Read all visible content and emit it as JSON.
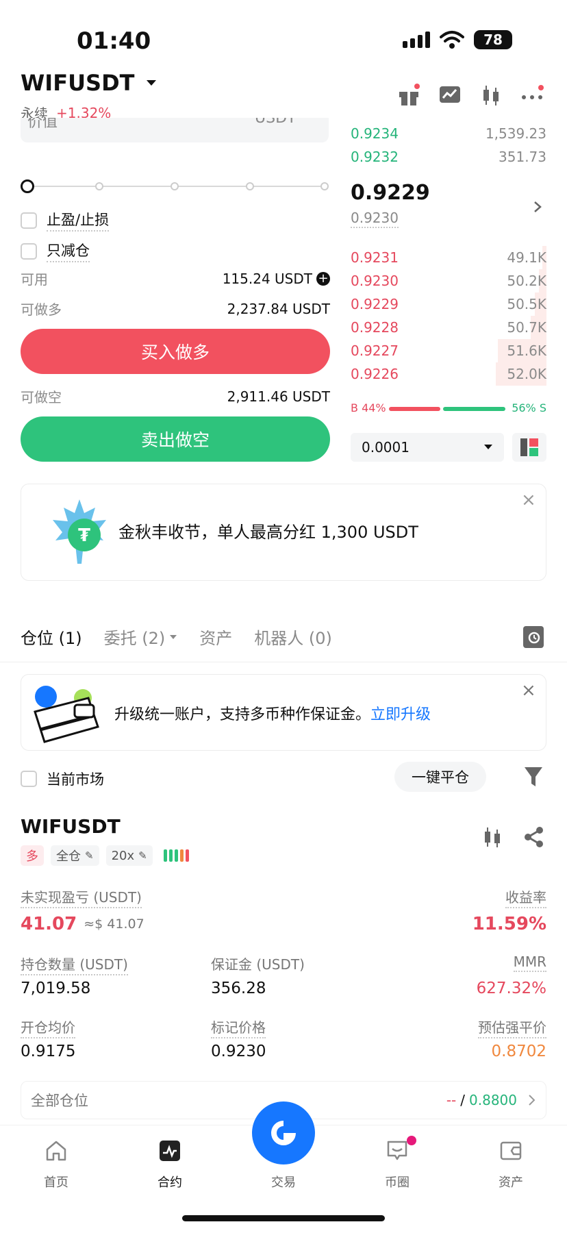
{
  "status_bar": {
    "time": "01:40",
    "battery": "78"
  },
  "header": {
    "symbol": "WIFUSDT",
    "type": "永续",
    "change": "+1.32%"
  },
  "order_form": {
    "price_label_partial": "价值",
    "price_unit_partial": "USDT",
    "tp_sl_label": "止盈/止损",
    "reduce_only_label": "只减仓",
    "available_label": "可用",
    "available_value": "115.24 USDT",
    "can_long_label": "可做多",
    "can_long_value": "2,237.84 USDT",
    "buy_button": "买入做多",
    "can_short_label": "可做空",
    "can_short_value": "2,911.46 USDT",
    "sell_button": "卖出做空"
  },
  "orderbook": {
    "asks_top": [
      {
        "price": "0.9234",
        "qty": "1,539.23"
      },
      {
        "price": "0.9232",
        "qty": "351.73"
      }
    ],
    "last_price": "0.9229",
    "mark_price": "0.9230",
    "bids": [
      {
        "price": "0.9231",
        "qty": "49.1K",
        "depth": 0.02
      },
      {
        "price": "0.9230",
        "qty": "50.2K",
        "depth": 0.04
      },
      {
        "price": "0.9229",
        "qty": "50.5K",
        "depth": 0.06
      },
      {
        "price": "0.9228",
        "qty": "50.7K",
        "depth": 0.08
      },
      {
        "price": "0.9227",
        "qty": "51.6K",
        "depth": 0.25
      },
      {
        "price": "0.9226",
        "qty": "52.0K",
        "depth": 0.26
      }
    ],
    "buy_ratio_label": "B 44%",
    "sell_ratio_label": "56% S",
    "buy_ratio": 0.44,
    "precision": "0.0001"
  },
  "promo_banner": {
    "text": "金秋丰收节，单人最高分红 1,300 USDT"
  },
  "tabs": [
    {
      "label": "仓位 (1)"
    },
    {
      "label": "委托 (2)"
    },
    {
      "label": "资产"
    },
    {
      "label": "机器人 (0)"
    }
  ],
  "upgrade_banner": {
    "text": "升级统一账户，支持多币种作保证金。",
    "link": "立即升级"
  },
  "filter_bar": {
    "current_market": "当前市场",
    "close_all": "一键平仓"
  },
  "position": {
    "symbol": "WIFUSDT",
    "side": "多",
    "margin_mode": "全仓",
    "leverage": "20x",
    "unrealized_pnl_label": "未实现盈亏 (USDT)",
    "unrealized_pnl": "41.07",
    "unrealized_pnl_usd": "≈$ 41.07",
    "roe_label": "收益率",
    "roe": "11.59%",
    "size_label": "持仓数量 (USDT)",
    "size": "7,019.58",
    "margin_label": "保证金 (USDT)",
    "margin": "356.28",
    "mmr_label": "MMR",
    "mmr": "627.32%",
    "entry_label": "开仓均价",
    "entry": "0.9175",
    "mark_label": "标记价格",
    "mark": "0.9230",
    "liq_label": "预估强平价",
    "liq": "0.8702",
    "all_positions_label": "全部仓位",
    "tp_value": "--",
    "sl_value": "0.8800"
  },
  "bottom_nav": [
    {
      "label": "首页"
    },
    {
      "label": "合约"
    },
    {
      "label": "交易"
    },
    {
      "label": "币圈"
    },
    {
      "label": "资产"
    }
  ],
  "colors": {
    "red": "#f2515f",
    "green": "#2ec37c",
    "blue": "#1677ff"
  }
}
